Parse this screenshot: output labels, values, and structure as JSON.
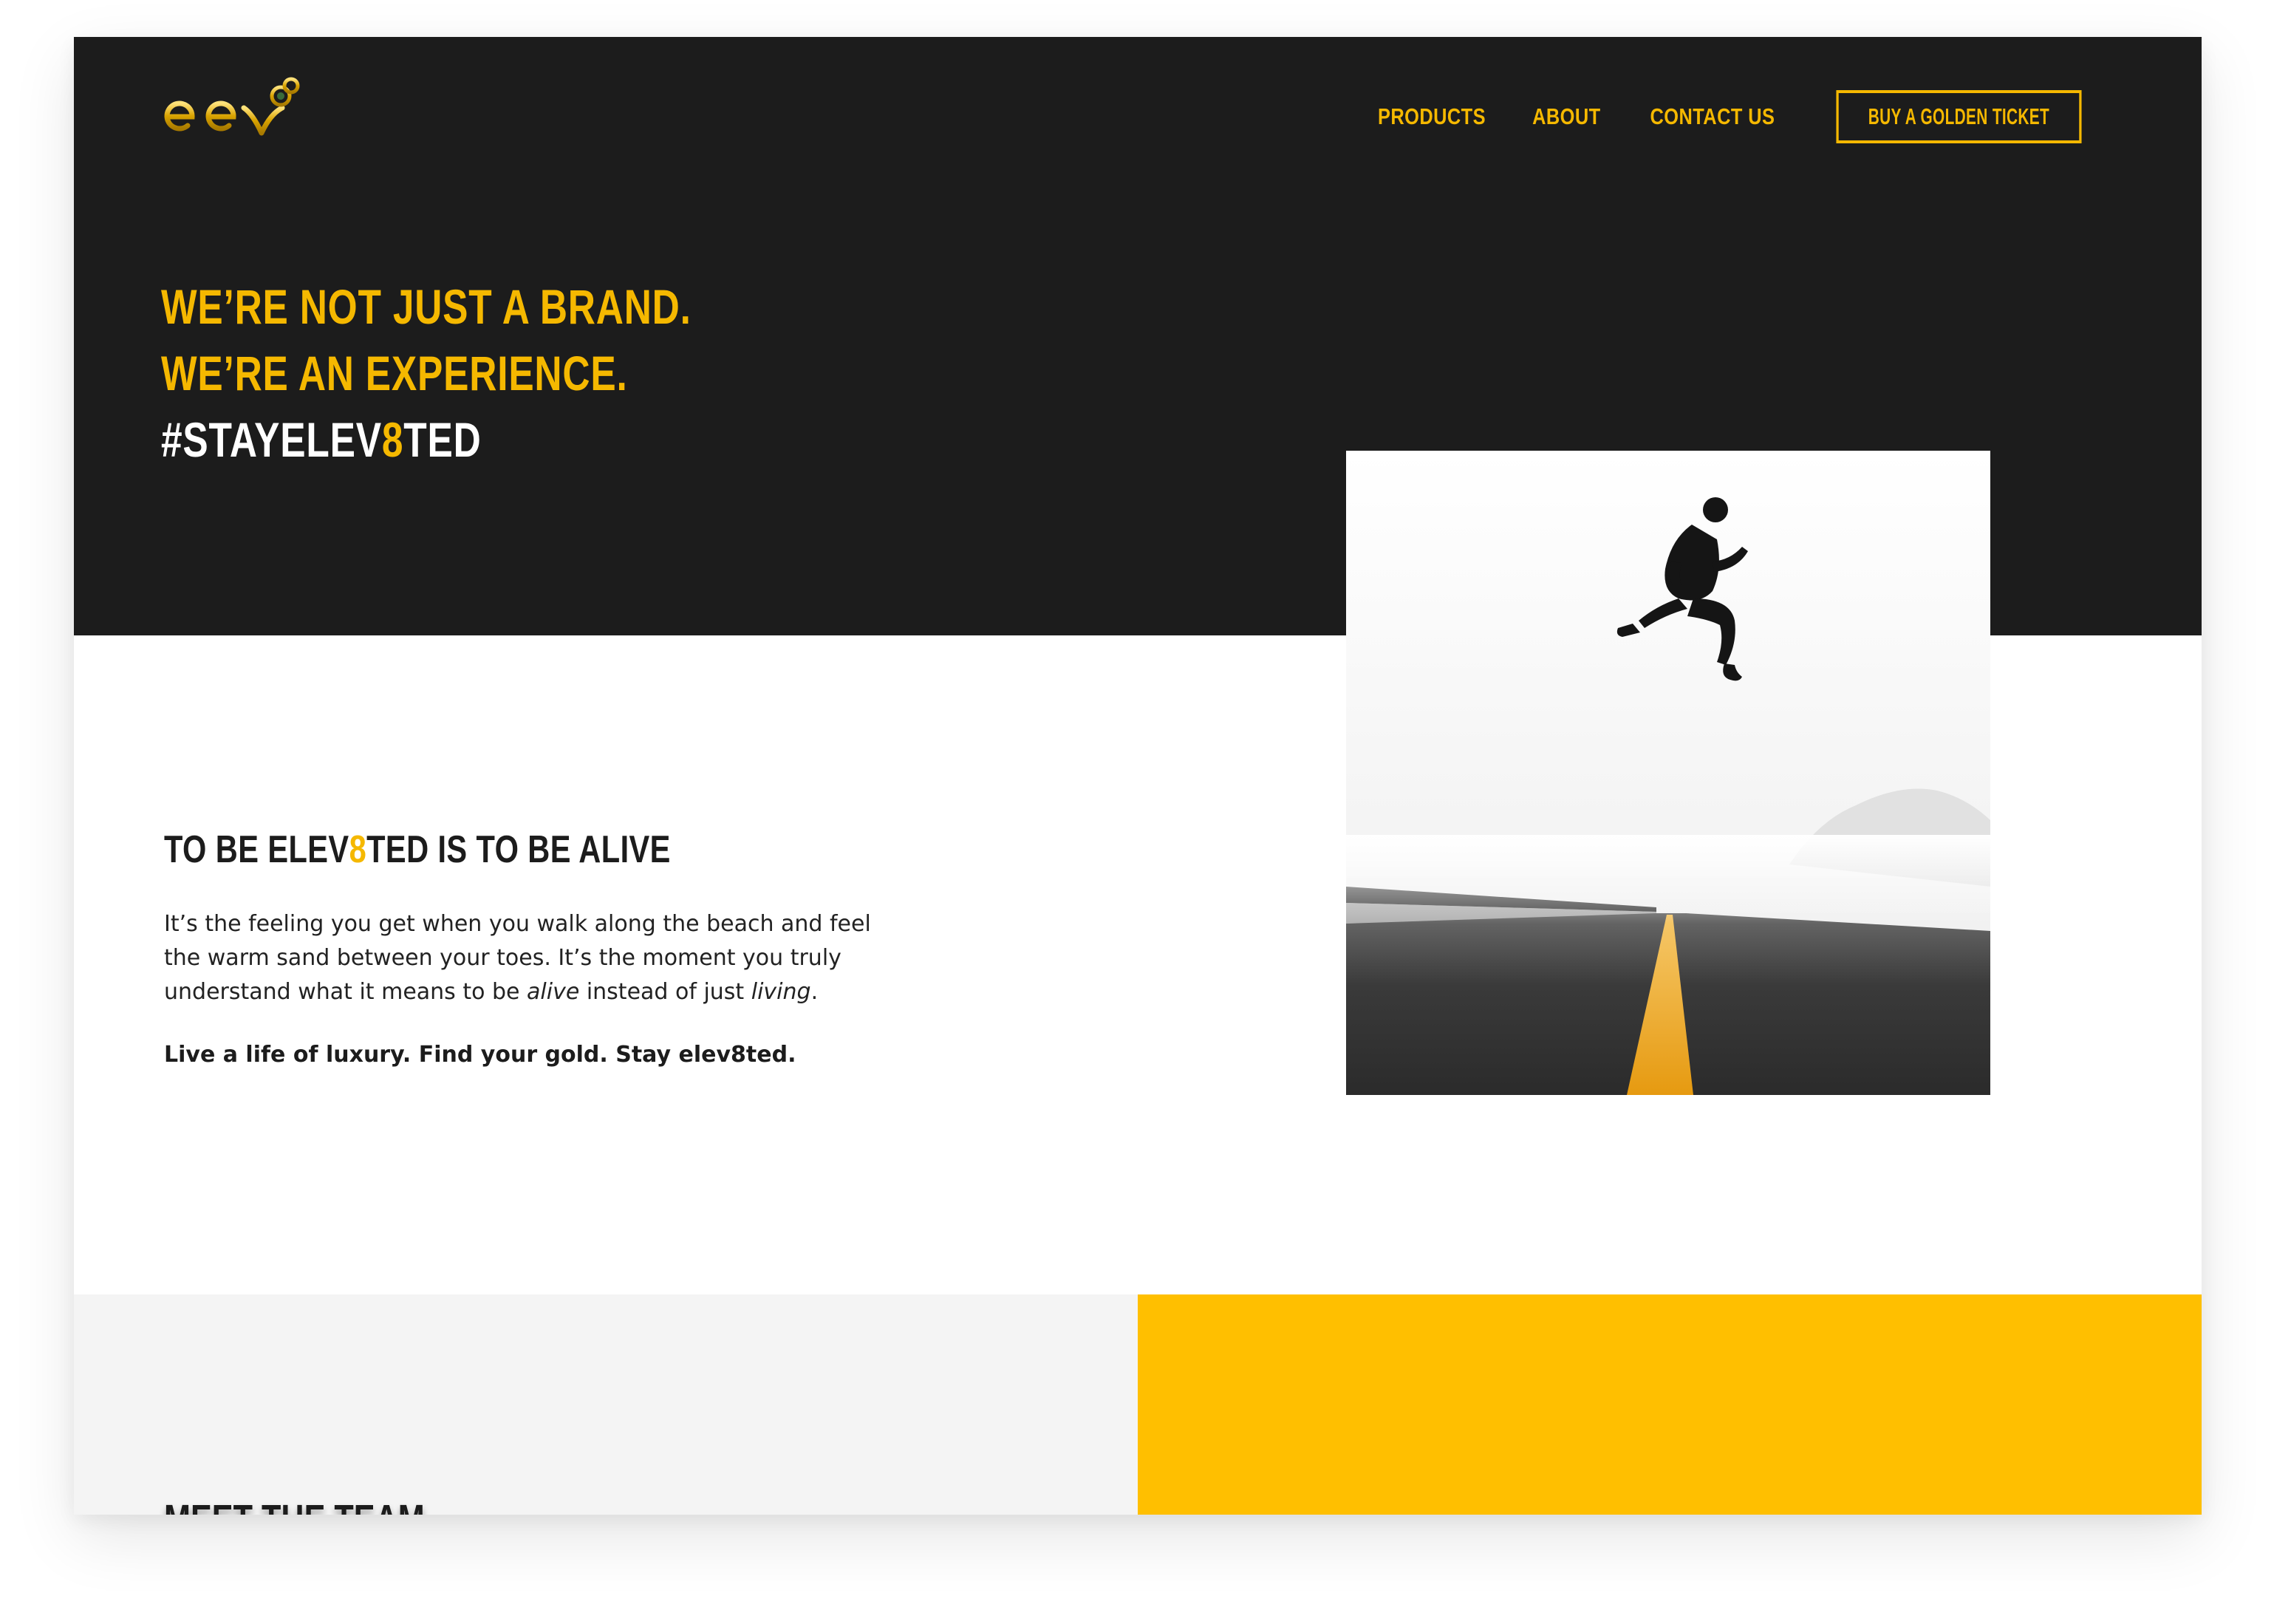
{
  "brand": {
    "name": "elev",
    "gold": "#f5b800",
    "dark": "#1c1c1c",
    "team_accent": "#ffbf00"
  },
  "nav": {
    "items": [
      {
        "label": "PRODUCTS"
      },
      {
        "label": "ABOUT"
      },
      {
        "label": "CONTACT US"
      }
    ],
    "cta_label": "BUY A GOLDEN TICKET"
  },
  "hero": {
    "line1": "WE’RE NOT JUST A BRAND.",
    "line2": "WE’RE AN EXPERIENCE.",
    "hashtag_pre": "#STAYELEV",
    "hashtag_digit": "8",
    "hashtag_post": "TED"
  },
  "alive": {
    "heading_pre": "TO BE ELEV",
    "heading_digit": "8",
    "heading_post": "TED IS TO BE ALIVE",
    "body_1": "It’s the feeling you get when you walk along the beach and feel the warm sand between your toes. It’s the moment you truly understand what it means to be ",
    "body_alive": "alive",
    "body_2": " instead of just ",
    "body_living": "living",
    "body_3": ".",
    "tagline": "Live a life of luxury. Find your gold. Stay elev8ted."
  },
  "team": {
    "title": "MEET THE TEAM"
  },
  "icons": {
    "logo": "elev-logo-icon",
    "photo": "jumping-man-road-photo"
  }
}
